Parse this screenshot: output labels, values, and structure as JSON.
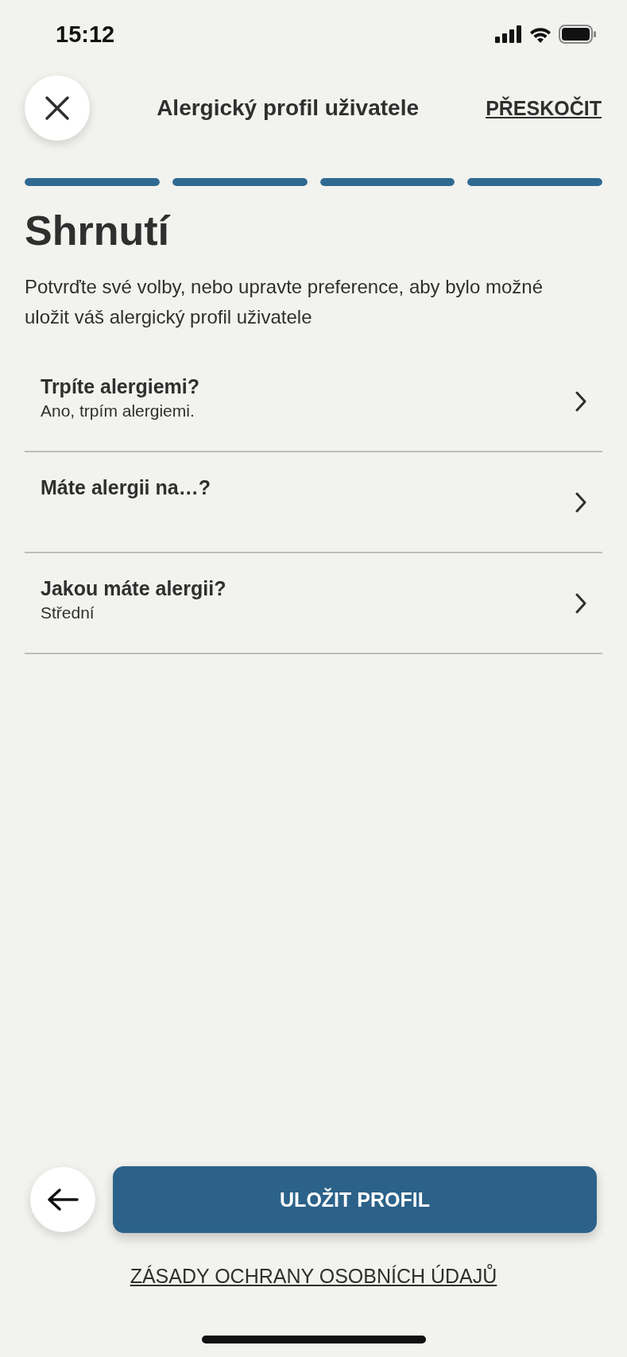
{
  "status_bar": {
    "time": "15:12"
  },
  "header": {
    "title": "Alergický profil uživatele",
    "skip": "PŘESKOČIT"
  },
  "progress": [
    {
      "level": 1
    },
    {
      "level": 1
    },
    {
      "level": 1
    },
    {
      "level": 1
    }
  ],
  "heading": "Shrnutí",
  "intro": "Potvrďte své volby, nebo upravte preference, aby bylo možné uložit váš alergický profil uživatele",
  "rows": [
    {
      "title": "Trpíte alergiemi?",
      "value": "Ano, trpím alergiemi."
    },
    {
      "title": "Máte alergii na…?"
    },
    {
      "title": "Jakou máte alergii?",
      "value": "Střední"
    }
  ],
  "save_button": "ULOŽIT PROFIL",
  "privacy_link": "ZÁSADY OCHRANY OSOBNÍCH ÚDAJŮ"
}
